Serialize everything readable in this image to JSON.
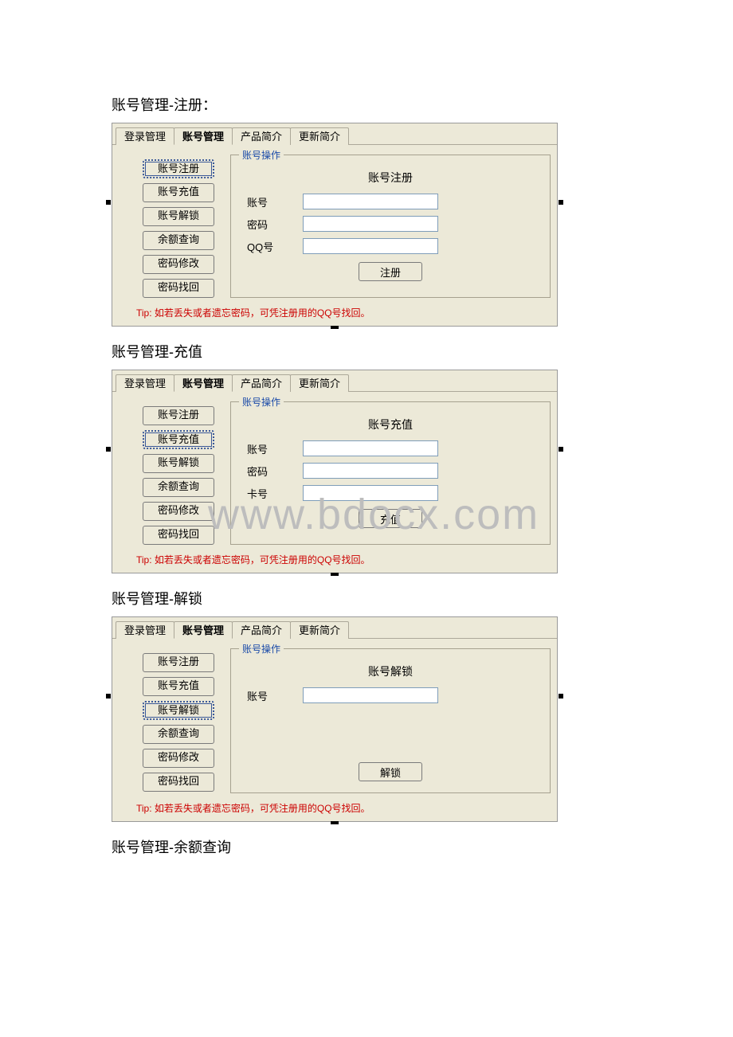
{
  "sections": [
    {
      "title": "账号管理-注册："
    },
    {
      "title": "账号管理-充值"
    },
    {
      "title": "账号管理-解锁"
    },
    {
      "title": "账号管理-余额查询"
    }
  ],
  "tabs": [
    "登录管理",
    "账号管理",
    "产品简介",
    "更新简介"
  ],
  "sideButtons": [
    "账号注册",
    "账号充值",
    "账号解锁",
    "余额查询",
    "密码修改",
    "密码找回"
  ],
  "groupLegend": "账号操作",
  "tip": "Tip: 如若丢失或者遗忘密码，可凭注册用的QQ号找回。",
  "panels": {
    "register": {
      "formTitle": "账号注册",
      "fields": [
        {
          "label": "账号"
        },
        {
          "label": "密码"
        },
        {
          "label": "QQ号"
        }
      ],
      "submit": "注册"
    },
    "recharge": {
      "formTitle": "账号充值",
      "fields": [
        {
          "label": "账号"
        },
        {
          "label": "密码"
        },
        {
          "label": "卡号"
        }
      ],
      "submit": "充值"
    },
    "unlock": {
      "formTitle": "账号解锁",
      "fields": [
        {
          "label": "账号"
        }
      ],
      "submit": "解锁"
    }
  },
  "watermark": "www.bdocx.com"
}
